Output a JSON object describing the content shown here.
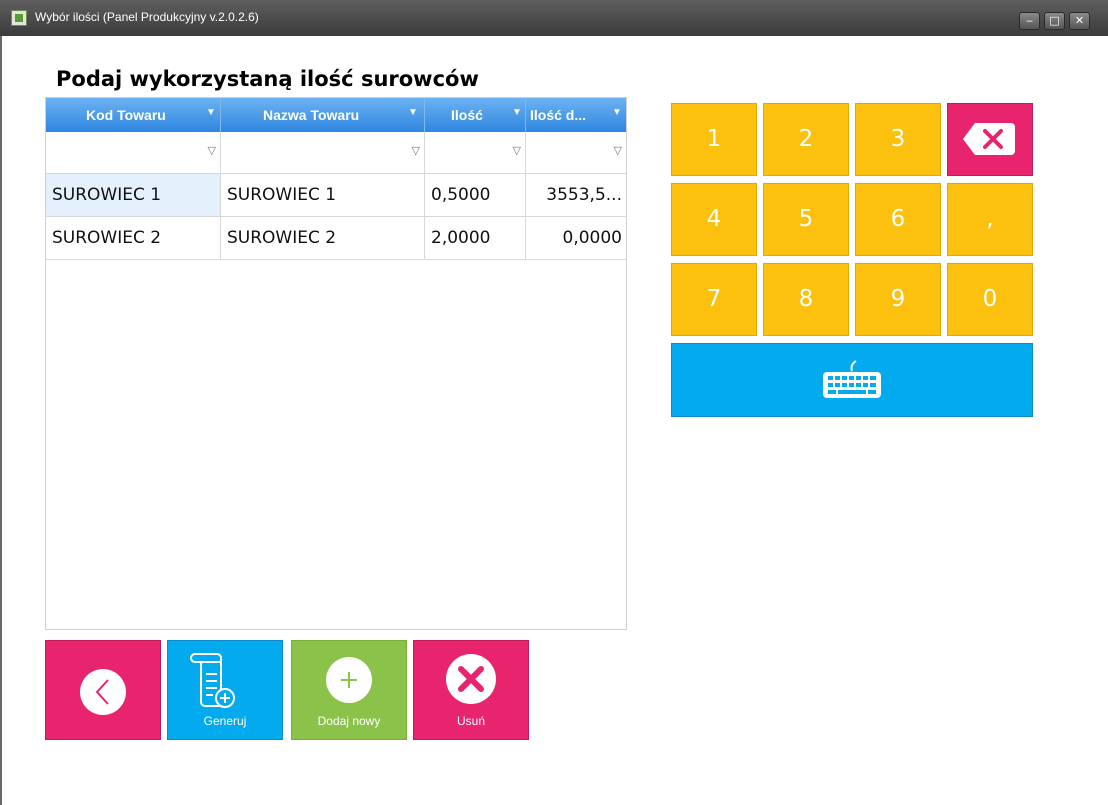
{
  "window": {
    "title": "Wybór ilości (Panel Produkcyjny v.2.0.2.6)",
    "controls": {
      "minimize": "‒",
      "maximize": "□",
      "close": "✕"
    }
  },
  "heading": "Podaj wykorzystaną ilość surowców",
  "grid": {
    "columns": [
      "Kod Towaru",
      "Nazwa Towaru",
      "Ilość",
      "Ilość d..."
    ],
    "rows": [
      [
        "SUROWIEC 1",
        "SUROWIEC 1",
        "0,5000",
        "3553,5..."
      ],
      [
        "SUROWIEC 2",
        "SUROWIEC 2",
        "2,0000",
        "0,0000"
      ]
    ]
  },
  "keypad": {
    "keys": [
      "1",
      "2",
      "3",
      "4",
      "5",
      "6",
      ",",
      "7",
      "8",
      "9",
      "0"
    ],
    "icons": {
      "backspace": "backspace-icon",
      "keyboard": "keyboard-icon"
    }
  },
  "actions": {
    "back": "",
    "generate": "Generuj",
    "add_new": "Dodaj nowy",
    "remove": "Usuń"
  },
  "colors": {
    "keypad_yellow": "#fcc10e",
    "accent_pink": "#e8246e",
    "accent_blue": "#03aaee",
    "accent_green": "#8bc34a",
    "header_blue": "#2e86df"
  }
}
